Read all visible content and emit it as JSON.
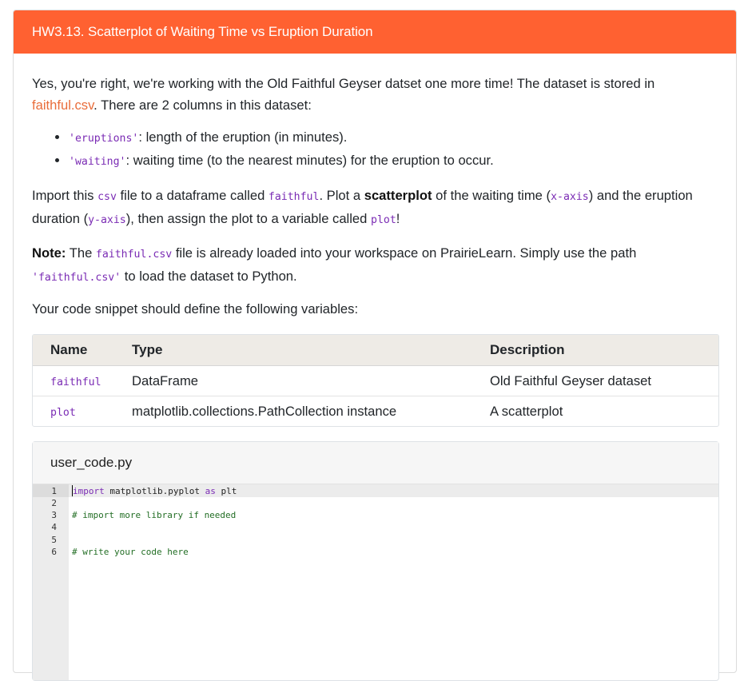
{
  "header": {
    "title": "HW3.13. Scatterplot of Waiting Time vs Eruption Duration"
  },
  "intro": {
    "part1": "Yes, you're right, we're working with the Old Faithful Geyser datset one more time! The dataset is stored in ",
    "link": "faithful.csv",
    "part2": ". There are 2 columns in this dataset:"
  },
  "columns": [
    {
      "code": "'eruptions'",
      "desc": ": length of the eruption (in minutes)."
    },
    {
      "code": "'waiting'",
      "desc": ": waiting time (to the nearest minutes) for the eruption to occur."
    }
  ],
  "instructions": {
    "t1": "Import this ",
    "c1": "csv",
    "t2": " file to a dataframe called ",
    "c2": "faithful",
    "t3": ". Plot a ",
    "b1": "scatterplot",
    "t4": " of the waiting time (",
    "c3": "x-axis",
    "t5": ") and the eruption duration (",
    "c4": "y-axis",
    "t6": "), then assign the plot to a variable called ",
    "c5": "plot",
    "t7": "!"
  },
  "note": {
    "label": "Note:",
    "t1": " The ",
    "c1": "faithful.csv",
    "t2": " file is already loaded into your workspace on PrairieLearn. Simply use the path ",
    "c2": "'faithful.csv'",
    "t3": " to load the dataset to Python."
  },
  "define_text": "Your code snippet should define the following variables:",
  "variables_table": {
    "headers": [
      "Name",
      "Type",
      "Description"
    ],
    "rows": [
      {
        "name": "faithful",
        "type": "DataFrame",
        "description": "Old Faithful Geyser dataset"
      },
      {
        "name": "plot",
        "type": "matplotlib.collections.PathCollection instance",
        "description": "A scatterplot"
      }
    ]
  },
  "code_panel": {
    "filename": "user_code.py",
    "line_numbers": [
      "1",
      "2",
      "3",
      "4",
      "5",
      "6"
    ],
    "lines": {
      "l1_kw": "import",
      "l1_rest": " matplotlib.pyplot ",
      "l1_as": "as",
      "l1_end": " plt",
      "l3": "# import more library if needed",
      "l6": "# write your code here"
    }
  },
  "colors": {
    "header_bg": "#ff6131",
    "link": "#e96d3b",
    "code": "#7a2bb4",
    "comment": "#236e25"
  }
}
